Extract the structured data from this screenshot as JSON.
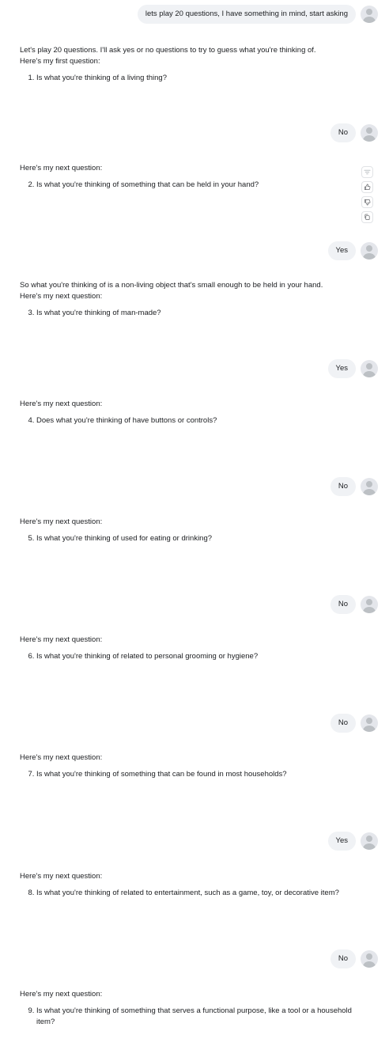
{
  "messages": [
    {
      "role": "user",
      "text": "lets play 20 questions, I have something in mind, start asking"
    },
    {
      "role": "assistant",
      "paragraphs": [
        "Let's play 20 questions. I'll ask yes or no questions to try to guess what you're thinking of.",
        "Here's my first question:"
      ],
      "number": 1,
      "question": "Is what you're thinking of a living thing?"
    },
    {
      "role": "user",
      "text": "No"
    },
    {
      "role": "assistant",
      "paragraphs": [
        "Here's my next question:"
      ],
      "number": 2,
      "question": "Is what you're thinking of something that can be held in your hand?"
    },
    {
      "role": "user",
      "text": "Yes"
    },
    {
      "role": "assistant",
      "paragraphs": [
        "So what you're thinking of is a non-living object that's small enough to be held in your hand.",
        "Here's my next question:"
      ],
      "number": 3,
      "question": "Is what you're thinking of man-made?"
    },
    {
      "role": "user",
      "text": "Yes"
    },
    {
      "role": "assistant",
      "paragraphs": [
        "Here's my next question:"
      ],
      "number": 4,
      "question": "Does what you're thinking of have buttons or controls?"
    },
    {
      "role": "user",
      "text": "No"
    },
    {
      "role": "assistant",
      "paragraphs": [
        "Here's my next question:"
      ],
      "number": 5,
      "question": "Is what you're thinking of used for eating or drinking?"
    },
    {
      "role": "user",
      "text": "No"
    },
    {
      "role": "assistant",
      "paragraphs": [
        "Here's my next question:"
      ],
      "number": 6,
      "question": "Is what you're thinking of related to personal grooming or hygiene?"
    },
    {
      "role": "user",
      "text": "No"
    },
    {
      "role": "assistant",
      "paragraphs": [
        "Here's my next question:"
      ],
      "number": 7,
      "question": "Is what you're thinking of something that can be found in most households?"
    },
    {
      "role": "user",
      "text": "Yes"
    },
    {
      "role": "assistant",
      "paragraphs": [
        "Here's my next question:"
      ],
      "number": 8,
      "question": "Is what you're thinking of related to entertainment, such as a game, toy, or decorative item?"
    },
    {
      "role": "user",
      "text": "No"
    },
    {
      "role": "assistant",
      "paragraphs": [
        "Here's my next question:"
      ],
      "number": 9,
      "question": "Is what you're thinking of something that serves a functional purpose, like a tool or a household item?"
    }
  ],
  "message_actions": {
    "icons": [
      "filter-icon",
      "thumbs-up-icon",
      "thumbs-down-icon",
      "copy-icon"
    ]
  },
  "colors": {
    "user_bubble_bg": "#f0f2f5",
    "text": "#1c1e21",
    "avatar_bg": "#e4e6eb"
  }
}
